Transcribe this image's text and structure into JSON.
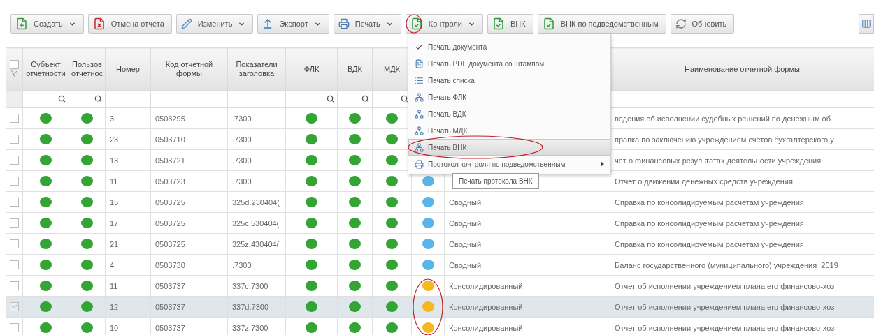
{
  "toolbar": [
    {
      "label": "Создать",
      "kind": "create",
      "dropdown": true
    },
    {
      "label": "Отмена отчета",
      "kind": "cancel",
      "dropdown": false
    },
    {
      "label": "Изменить",
      "kind": "edit",
      "dropdown": true
    },
    {
      "label": "Экспорт",
      "kind": "export",
      "dropdown": true
    },
    {
      "label": "Печать",
      "kind": "print",
      "dropdown": true
    },
    {
      "label": "Контроли",
      "kind": "check",
      "dropdown": true
    },
    {
      "label": "ВНК",
      "kind": "check",
      "dropdown": false
    },
    {
      "label": "ВНК по подведомственным",
      "kind": "check",
      "dropdown": false
    },
    {
      "label": "Обновить",
      "kind": "refresh",
      "dropdown": false
    }
  ],
  "table": {
    "select_all": {
      "checked": false
    },
    "columns": [
      {
        "label": "Субъект отчетности",
        "search": true
      },
      {
        "label": "Пользов отчетнос",
        "search": true
      },
      {
        "label": "Номер",
        "search": false
      },
      {
        "label": "Код отчетной формы",
        "search": false
      },
      {
        "label": "Показатели заголовка",
        "search": false
      },
      {
        "label": "ФЛК",
        "search": true
      },
      {
        "label": "ВДК",
        "search": true
      },
      {
        "label": "МДК",
        "search": true
      },
      {},
      {},
      {
        "label": "Наименование отчетной формы",
        "search": false
      }
    ],
    "rows": [
      {
        "checked": false,
        "selected": false,
        "statuses": [
          {
            "color": "#34a534"
          },
          {
            "color": "#34a534"
          },
          {
            "color": "#34a534"
          },
          {
            "color": "#34a534"
          },
          {
            "color": "#34a534"
          }
        ],
        "number": "3",
        "code": "0503295",
        "indicators": ".7300",
        "name": "ведения об исполнении судебных решений по денежным об"
      },
      {
        "checked": false,
        "selected": false,
        "statuses": [
          {
            "color": "#34a534"
          },
          {
            "color": "#34a534"
          },
          {
            "color": "#34a534"
          },
          {
            "color": "#34a534"
          },
          {
            "color": "#34a534"
          }
        ],
        "number": "23",
        "code": "0503710",
        "indicators": ".7300",
        "name": "правка по заключению учреждением счетов бухгалтерского у"
      },
      {
        "checked": false,
        "selected": false,
        "statuses": [
          {
            "color": "#34a534"
          },
          {
            "color": "#34a534"
          },
          {
            "color": "#34a534"
          },
          {
            "color": "#34a534"
          },
          {
            "color": "#34a534"
          }
        ],
        "number": "13",
        "code": "0503721",
        "indicators": ".7300",
        "name": "чёт о финансовых результатах деятельности учреждения"
      },
      {
        "checked": false,
        "selected": false,
        "statuses": [
          {
            "color": "#34a534"
          },
          {
            "color": "#34a534"
          },
          {
            "color": "#34a534"
          },
          {
            "color": "#34a534"
          },
          {
            "color": "#34a534"
          },
          {
            "color": "#5ab4e6"
          }
        ],
        "number": "11",
        "code": "0503723",
        "indicators": ".7300",
        "name": "Отчет о движении денежных средств учреждения"
      },
      {
        "checked": false,
        "selected": false,
        "statuses": [
          {
            "color": "#34a534"
          },
          {
            "color": "#34a534"
          },
          {
            "color": "#34a534"
          },
          {
            "color": "#34a534"
          },
          {
            "color": "#34a534"
          },
          {
            "color": "#5ab4e6"
          }
        ],
        "number": "15",
        "code": "0503725",
        "indicators": "325d.230404(",
        "type": "Сводный",
        "name": "Справка по консолидируемым расчетам учреждения"
      },
      {
        "checked": false,
        "selected": false,
        "statuses": [
          {
            "color": "#34a534"
          },
          {
            "color": "#34a534"
          },
          {
            "color": "#34a534"
          },
          {
            "color": "#34a534"
          },
          {
            "color": "#34a534"
          },
          {
            "color": "#5ab4e6"
          }
        ],
        "number": "17",
        "code": "0503725",
        "indicators": "325c.530404(",
        "type": "Сводный",
        "name": "Справка по консолидируемым расчетам учреждения"
      },
      {
        "checked": false,
        "selected": false,
        "statuses": [
          {
            "color": "#34a534"
          },
          {
            "color": "#34a534"
          },
          {
            "color": "#34a534"
          },
          {
            "color": "#34a534"
          },
          {
            "color": "#34a534"
          },
          {
            "color": "#5ab4e6"
          }
        ],
        "number": "21",
        "code": "0503725",
        "indicators": "325z.430404(",
        "type": "Сводный",
        "name": "Справка по консолидируемым расчетам учреждения"
      },
      {
        "checked": false,
        "selected": false,
        "statuses": [
          {
            "color": "#34a534"
          },
          {
            "color": "#34a534"
          },
          {
            "color": "#34a534"
          },
          {
            "color": "#34a534"
          },
          {
            "color": "#34a534"
          },
          {
            "color": "#5ab4e6"
          }
        ],
        "number": "4",
        "code": "0503730",
        "indicators": ".7300",
        "type": "Сводный",
        "name": "Баланс государственного (муниципального) учреждения_2019"
      },
      {
        "checked": false,
        "selected": false,
        "statuses": [
          {
            "color": "#34a534"
          },
          {
            "color": "#34a534"
          },
          {
            "color": "#34a534"
          },
          {
            "color": "#34a534"
          },
          {
            "color": "#34a534"
          },
          {
            "color": "#f5b820"
          }
        ],
        "number": "11",
        "code": "0503737",
        "indicators": "337c.7300",
        "type": "Консолидированный",
        "name": "Отчет об исполнении учреждением плана его финансово-хоз"
      },
      {
        "checked": true,
        "selected": true,
        "statuses": [
          {
            "color": "#34a534"
          },
          {
            "color": "#34a534"
          },
          {
            "color": "#34a534"
          },
          {
            "color": "#34a534"
          },
          {
            "color": "#34a534"
          },
          {
            "color": "#f5b820"
          }
        ],
        "number": "12",
        "code": "0503737",
        "indicators": "337d.7300",
        "type": "Консолидированный",
        "name": "Отчет об исполнении учреждением плана его финансово-хоз"
      },
      {
        "checked": false,
        "selected": false,
        "statuses": [
          {
            "color": "#34a534"
          },
          {
            "color": "#34a534"
          },
          {
            "color": "#34a534"
          },
          {
            "color": "#34a534"
          },
          {
            "color": "#34a534"
          },
          {
            "color": "#f5b820"
          }
        ],
        "number": "10",
        "code": "0503737",
        "indicators": "337z.7300",
        "type": "Консолидированный",
        "name": "Отчет об исполнении учреждением плана его финансово-хоз"
      }
    ]
  },
  "print_menu": {
    "items": [
      {
        "label": "Печать документа",
        "kind": "check",
        "selected": false,
        "submenu": false
      },
      {
        "label": "Печать PDF документа со штампом",
        "kind": "pdf",
        "selected": false,
        "submenu": false
      },
      {
        "label": "Печать списка",
        "kind": "list",
        "selected": false,
        "submenu": false
      },
      {
        "label": "Печать ФЛК",
        "kind": "control",
        "selected": false,
        "submenu": false
      },
      {
        "label": "Печать ВДК",
        "kind": "control",
        "selected": false,
        "submenu": false
      },
      {
        "label": "Печать МДК",
        "kind": "control",
        "selected": false,
        "submenu": false
      },
      {
        "label": "Печать ВНК",
        "kind": "control",
        "selected": true,
        "submenu": false
      },
      {
        "label": "Протокол контроля по подведомственным",
        "kind": "print",
        "selected": false,
        "submenu": true
      }
    ]
  },
  "tooltip": "Печать протокола ВНК"
}
